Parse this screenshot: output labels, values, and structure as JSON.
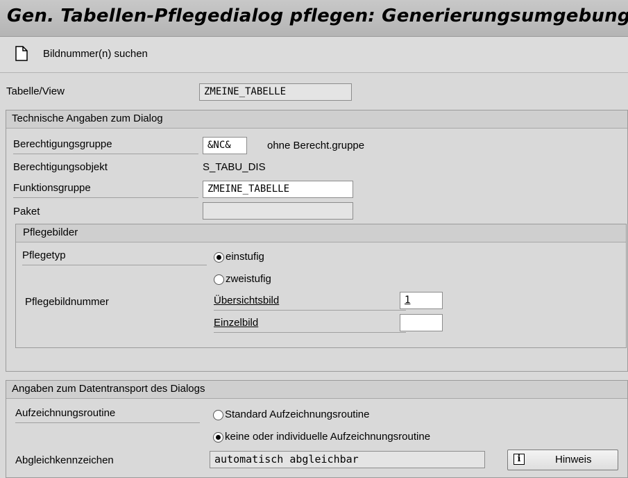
{
  "window": {
    "title": "Gen. Tabellen-Pflegedialog pflegen: Generierungsumgebung"
  },
  "toolbar": {
    "search_label": "Bildnummer(n) suchen",
    "icon": "document-icon"
  },
  "table_view": {
    "label": "Tabelle/View",
    "value": "ZMEINE_TABELLE"
  },
  "tech": {
    "title": "Technische Angaben zum Dialog",
    "auth_group": {
      "label": "Berechtigungsgruppe",
      "value": "&NC&",
      "note": "ohne Berecht.gruppe"
    },
    "auth_object": {
      "label": "Berechtigungsobjekt",
      "value": "S_TABU_DIS"
    },
    "function_group": {
      "label": "Funktionsgruppe",
      "value": "ZMEINE_TABELLE"
    },
    "package": {
      "label": "Paket",
      "value": ""
    },
    "screens": {
      "title": "Pflegebilder",
      "type_label": "Pflegetyp",
      "option_single": "einstufig",
      "option_two": "zweistufig",
      "selected": "einstufig",
      "number_label": "Pflegebildnummer",
      "overview_label": "Übersichtsbild",
      "overview_value": "1",
      "single_label": "Einzelbild",
      "single_value": ""
    }
  },
  "transport": {
    "title": "Angaben zum Datentransport des Dialogs",
    "routine_label": "Aufzeichnungsroutine",
    "option_standard": "Standard Aufzeichnungsroutine",
    "option_none": "keine oder individuelle Aufzeichnungsroutine",
    "selected": "keine oder individuelle Aufzeichnungsroutine",
    "compare_label": "Abgleichkennzeichen",
    "compare_value": "automatisch abgleichbar",
    "hint_button": "Hinweis",
    "hint_icon": "info-icon"
  }
}
